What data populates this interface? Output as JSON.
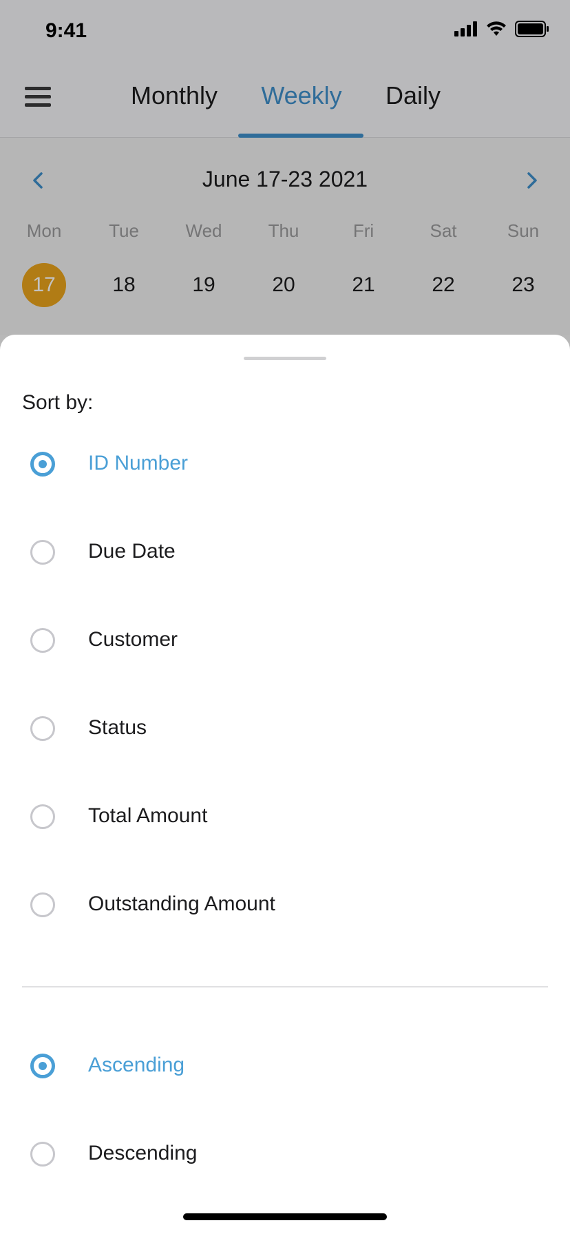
{
  "status_bar": {
    "time": "9:41"
  },
  "nav": {
    "tabs": [
      {
        "label": "Monthly",
        "active": false
      },
      {
        "label": "Weekly",
        "active": true
      },
      {
        "label": "Daily",
        "active": false
      }
    ]
  },
  "week": {
    "range": "June 17-23 2021",
    "days": [
      {
        "name": "Mon",
        "num": "17",
        "selected": true
      },
      {
        "name": "Tue",
        "num": "18",
        "selected": false
      },
      {
        "name": "Wed",
        "num": "19",
        "selected": false
      },
      {
        "name": "Thu",
        "num": "20",
        "selected": false
      },
      {
        "name": "Fri",
        "num": "21",
        "selected": false
      },
      {
        "name": "Sat",
        "num": "22",
        "selected": false
      },
      {
        "name": "Sun",
        "num": "23",
        "selected": false
      }
    ]
  },
  "sheet": {
    "title": "Sort by:",
    "sort_options": [
      {
        "label": "ID Number",
        "checked": true
      },
      {
        "label": "Due Date",
        "checked": false
      },
      {
        "label": "Customer",
        "checked": false
      },
      {
        "label": "Status",
        "checked": false
      },
      {
        "label": "Total Amount",
        "checked": false
      },
      {
        "label": "Outstanding Amount",
        "checked": false
      }
    ],
    "order_options": [
      {
        "label": "Ascending",
        "checked": true
      },
      {
        "label": "Descending",
        "checked": false
      }
    ]
  },
  "colors": {
    "accent": "#4a9fd6",
    "nav_accent": "#3f8ec9",
    "selected_day": "#e9a31c"
  },
  "icons": [
    "signal-icon",
    "wifi-icon",
    "battery-icon",
    "hamburger-menu-icon",
    "chevron-left-icon",
    "chevron-right-icon"
  ]
}
